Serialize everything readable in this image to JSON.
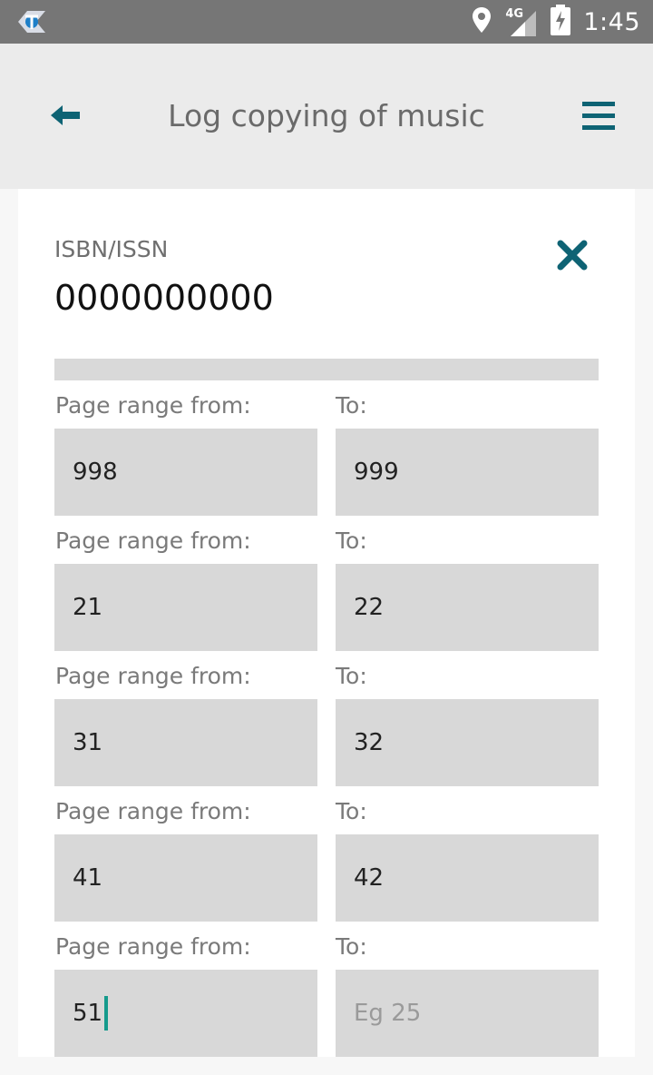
{
  "statusbar": {
    "time": "1:45",
    "network": "4G"
  },
  "appbar": {
    "title": "Log copying of music",
    "back_icon": "back-arrow-icon",
    "menu_icon": "hamburger-menu-icon"
  },
  "form": {
    "isbn_label": "ISBN/ISSN",
    "isbn_value": "0000000000",
    "clear_icon": "close-icon",
    "ranges": [
      {
        "from_label": "Page range from:",
        "to_label": "To:",
        "from_value": "998",
        "to_value": "999"
      },
      {
        "from_label": "Page range from:",
        "to_label": "To:",
        "from_value": "21",
        "to_value": "22"
      },
      {
        "from_label": "Page range from:",
        "to_label": "To:",
        "from_value": "31",
        "to_value": "32"
      },
      {
        "from_label": "Page range from:",
        "to_label": "To:",
        "from_value": "41",
        "to_value": "42"
      },
      {
        "from_label": "Page range from:",
        "to_label": "To:",
        "from_value": "51",
        "to_placeholder": "Eg 25"
      }
    ]
  },
  "colors": {
    "accent": "#0e6374",
    "caret": "#159a8c"
  }
}
